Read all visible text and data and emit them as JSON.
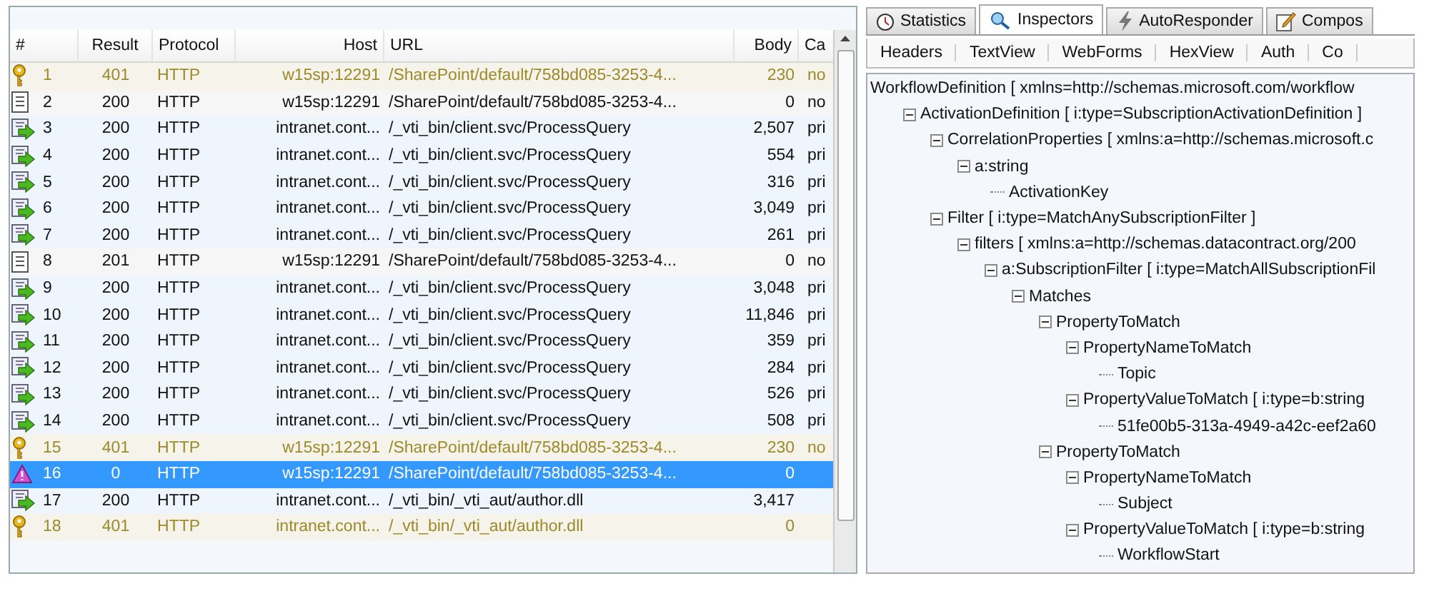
{
  "sessions": {
    "columns": [
      "#",
      "Result",
      "Protocol",
      "Host",
      "URL",
      "Body",
      "Ca"
    ],
    "rows": [
      {
        "kind": "auth",
        "num": "1",
        "result": "401",
        "protocol": "HTTP",
        "host": "w15sp:12291",
        "url": "/SharePoint/default/758bd085-3253-4...",
        "body": "230",
        "caching": "no",
        "selected": false
      },
      {
        "kind": "doc",
        "num": "2",
        "result": "200",
        "protocol": "HTTP",
        "host": "w15sp:12291",
        "url": "/SharePoint/default/758bd085-3253-4...",
        "body": "0",
        "caching": "no",
        "selected": false
      },
      {
        "kind": "query",
        "num": "3",
        "result": "200",
        "protocol": "HTTP",
        "host": "intranet.cont...",
        "url": "/_vti_bin/client.svc/ProcessQuery",
        "body": "2,507",
        "caching": "pri",
        "selected": false
      },
      {
        "kind": "query",
        "num": "4",
        "result": "200",
        "protocol": "HTTP",
        "host": "intranet.cont...",
        "url": "/_vti_bin/client.svc/ProcessQuery",
        "body": "554",
        "caching": "pri",
        "selected": false
      },
      {
        "kind": "query",
        "num": "5",
        "result": "200",
        "protocol": "HTTP",
        "host": "intranet.cont...",
        "url": "/_vti_bin/client.svc/ProcessQuery",
        "body": "316",
        "caching": "pri",
        "selected": false
      },
      {
        "kind": "query",
        "num": "6",
        "result": "200",
        "protocol": "HTTP",
        "host": "intranet.cont...",
        "url": "/_vti_bin/client.svc/ProcessQuery",
        "body": "3,049",
        "caching": "pri",
        "selected": false
      },
      {
        "kind": "query",
        "num": "7",
        "result": "200",
        "protocol": "HTTP",
        "host": "intranet.cont...",
        "url": "/_vti_bin/client.svc/ProcessQuery",
        "body": "261",
        "caching": "pri",
        "selected": false
      },
      {
        "kind": "doc",
        "num": "8",
        "result": "201",
        "protocol": "HTTP",
        "host": "w15sp:12291",
        "url": "/SharePoint/default/758bd085-3253-4...",
        "body": "0",
        "caching": "no",
        "selected": false
      },
      {
        "kind": "query",
        "num": "9",
        "result": "200",
        "protocol": "HTTP",
        "host": "intranet.cont...",
        "url": "/_vti_bin/client.svc/ProcessQuery",
        "body": "3,048",
        "caching": "pri",
        "selected": false
      },
      {
        "kind": "query",
        "num": "10",
        "result": "200",
        "protocol": "HTTP",
        "host": "intranet.cont...",
        "url": "/_vti_bin/client.svc/ProcessQuery",
        "body": "11,846",
        "caching": "pri",
        "selected": false
      },
      {
        "kind": "query",
        "num": "11",
        "result": "200",
        "protocol": "HTTP",
        "host": "intranet.cont...",
        "url": "/_vti_bin/client.svc/ProcessQuery",
        "body": "359",
        "caching": "pri",
        "selected": false
      },
      {
        "kind": "query",
        "num": "12",
        "result": "200",
        "protocol": "HTTP",
        "host": "intranet.cont...",
        "url": "/_vti_bin/client.svc/ProcessQuery",
        "body": "284",
        "caching": "pri",
        "selected": false
      },
      {
        "kind": "query",
        "num": "13",
        "result": "200",
        "protocol": "HTTP",
        "host": "intranet.cont...",
        "url": "/_vti_bin/client.svc/ProcessQuery",
        "body": "526",
        "caching": "pri",
        "selected": false
      },
      {
        "kind": "query",
        "num": "14",
        "result": "200",
        "protocol": "HTTP",
        "host": "intranet.cont...",
        "url": "/_vti_bin/client.svc/ProcessQuery",
        "body": "508",
        "caching": "pri",
        "selected": false
      },
      {
        "kind": "auth",
        "num": "15",
        "result": "401",
        "protocol": "HTTP",
        "host": "w15sp:12291",
        "url": "/SharePoint/default/758bd085-3253-4...",
        "body": "230",
        "caching": "no",
        "selected": false
      },
      {
        "kind": "warning",
        "num": "16",
        "result": "0",
        "protocol": "HTTP",
        "host": "w15sp:12291",
        "url": "/SharePoint/default/758bd085-3253-4...",
        "body": "0",
        "selected": true
      },
      {
        "kind": "query",
        "num": "17",
        "result": "200",
        "protocol": "HTTP",
        "host": "intranet.cont...",
        "url": "/_vti_bin/_vti_aut/author.dll",
        "body": "3,417",
        "selected": false
      },
      {
        "kind": "auth",
        "num": "18",
        "result": "401",
        "protocol": "HTTP",
        "host": "intranet.cont...",
        "url": "/_vti_bin/_vti_aut/author.dll",
        "body": "0",
        "selected": false
      }
    ]
  },
  "tabs": [
    {
      "kind": "stats",
      "label": "Statistics",
      "selected": false
    },
    {
      "kind": "inspect",
      "label": "Inspectors",
      "selected": true
    },
    {
      "kind": "auto",
      "label": "AutoResponder",
      "selected": false
    },
    {
      "kind": "compose",
      "label": "Compos",
      "selected": false
    }
  ],
  "subtabs": [
    "Headers",
    "TextView",
    "WebForms",
    "HexView",
    "Auth",
    "Co"
  ],
  "tree": [
    {
      "label": "WorkflowDefinition [ xmlns=http://schemas.microsoft.com/workflow",
      "children": [
        {
          "label": "ActivationDefinition [ i:type=SubscriptionActivationDefinition ]",
          "expanded": true,
          "children": [
            {
              "label": "CorrelationProperties [ xmlns:a=http://schemas.microsoft.c",
              "expanded": true,
              "children": [
                {
                  "label": "a:string",
                  "expanded": true,
                  "children": [
                    {
                      "label": "ActivationKey"
                    }
                  ]
                }
              ]
            },
            {
              "label": "Filter [ i:type=MatchAnySubscriptionFilter ]",
              "expanded": true,
              "children": [
                {
                  "label": "filters [ xmlns:a=http://schemas.datacontract.org/200",
                  "expanded": true,
                  "children": [
                    {
                      "label": "a:SubscriptionFilter [ i:type=MatchAllSubscriptionFil",
                      "expanded": true,
                      "children": [
                        {
                          "label": "Matches",
                          "expanded": true,
                          "children": [
                            {
                              "label": "PropertyToMatch",
                              "expanded": true,
                              "children": [
                                {
                                  "label": "PropertyNameToMatch",
                                  "expanded": true,
                                  "children": [
                                    {
                                      "label": "Topic"
                                    }
                                  ]
                                },
                                {
                                  "label": "PropertyValueToMatch [ i:type=b:string",
                                  "expanded": true,
                                  "children": [
                                    {
                                      "label": "51fe00b5-313a-4949-a42c-eef2a60"
                                    }
                                  ]
                                }
                              ]
                            },
                            {
                              "label": "PropertyToMatch",
                              "expanded": true,
                              "children": [
                                {
                                  "label": "PropertyNameToMatch",
                                  "expanded": true,
                                  "children": [
                                    {
                                      "label": "Subject"
                                    }
                                  ]
                                },
                                {
                                  "label": "PropertyValueToMatch [ i:type=b:string",
                                  "expanded": true,
                                  "children": [
                                    {
                                      "label": "WorkflowStart"
                                    }
                                  ]
                                }
                              ]
                            }
                          ]
                        }
                      ]
                    }
                  ]
                }
              ]
            }
          ]
        }
      ]
    }
  ]
}
